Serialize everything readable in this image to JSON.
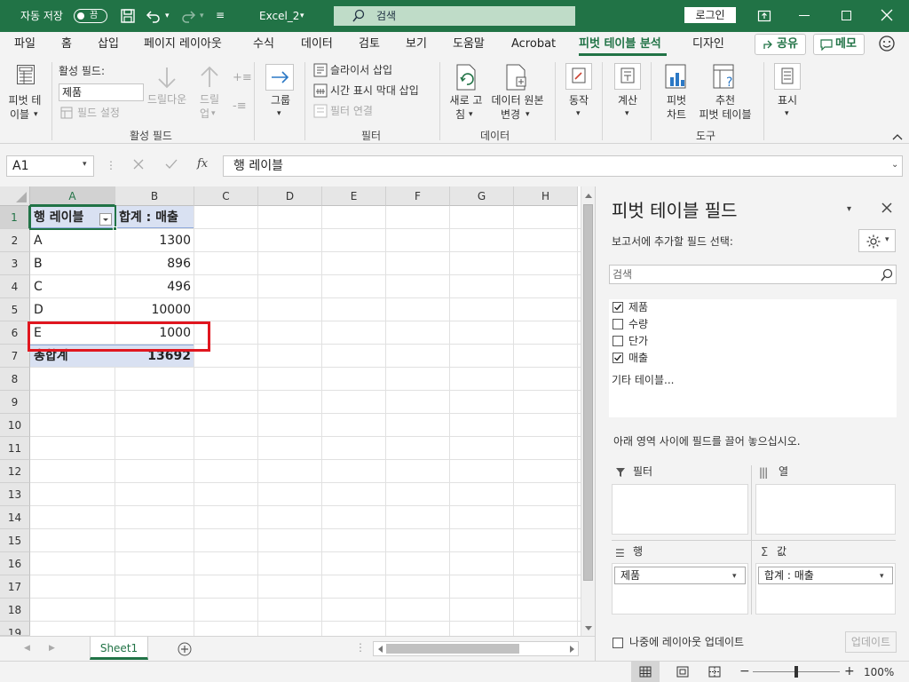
{
  "titlebar": {
    "autosave_label": "자동 저장",
    "autosave_state": "끔",
    "filename": "Excel_2",
    "search_placeholder": "검색",
    "login_label": "로그인"
  },
  "tabs": {
    "items": [
      "파일",
      "홈",
      "삽입",
      "페이지 레이아웃",
      "수식",
      "데이터",
      "검토",
      "보기",
      "도움말",
      "Acrobat",
      "피벗 테이블 분석",
      "디자인"
    ],
    "active": "피벗 테이블 분석",
    "share_label": "공유",
    "comment_label": "메모"
  },
  "ribbon": {
    "pivot_table": {
      "line1": "피벗 테",
      "line2": "이블"
    },
    "active_field": {
      "label": "활성 필드:",
      "value": "제품",
      "field_settings": "필드 설정",
      "drill_down": "드릴다운",
      "drill_up_1": "드릴",
      "drill_up_2": "업",
      "group_label": "활성 필드"
    },
    "group": {
      "label": "그룹"
    },
    "filter": {
      "slicer": "슬라이서 삽입",
      "timeline": "시간 표시 막대 삽입",
      "connections": "필터 연결",
      "group_label": "필터"
    },
    "data": {
      "refresh_1": "새로 고",
      "refresh_2": "침",
      "change_source_1": "데이터 원본",
      "change_source_2": "변경",
      "group_label": "데이터"
    },
    "actions": {
      "label": "동작"
    },
    "calculations": {
      "label": "계산"
    },
    "tools": {
      "pivot_chart_1": "피벗",
      "pivot_chart_2": "차트",
      "recommended_1": "추천",
      "recommended_2": "피벗 테이블",
      "group_label": "도구"
    },
    "show": {
      "label": "표시"
    }
  },
  "formula_bar": {
    "name_box": "A1",
    "formula": "행 레이블"
  },
  "grid": {
    "columns": [
      "A",
      "B",
      "C",
      "D",
      "E",
      "F",
      "G",
      "H"
    ],
    "rows": [
      "1",
      "2",
      "3",
      "4",
      "5",
      "6",
      "7",
      "8",
      "9",
      "10",
      "11",
      "12",
      "13",
      "14",
      "15",
      "16",
      "17",
      "18",
      "19"
    ],
    "header": {
      "row_label": "행 레이블",
      "sum_label": "합계 : 매출"
    },
    "data_rows": [
      {
        "label": "A",
        "value": "1300"
      },
      {
        "label": "B",
        "value": "896"
      },
      {
        "label": "C",
        "value": "496"
      },
      {
        "label": "D",
        "value": "10000"
      },
      {
        "label": "E",
        "value": "1000"
      }
    ],
    "total": {
      "label": "총합계",
      "value": "13692"
    },
    "highlight_color": "#e0161f",
    "pivot_header_fill": "#d9e1f2"
  },
  "sheets": {
    "tabs": [
      "Sheet1"
    ]
  },
  "pivot_pane": {
    "title": "피벗 테이블 필드",
    "subtitle": "보고서에 추가할 필드 선택:",
    "search_placeholder": "검색",
    "fields": [
      {
        "name": "제품",
        "checked": true
      },
      {
        "name": "수량",
        "checked": false
      },
      {
        "name": "단가",
        "checked": false
      },
      {
        "name": "매출",
        "checked": true
      }
    ],
    "more_tables": "기타 테이블...",
    "drag_hint": "아래 영역 사이에 필드를 끌어 놓으십시오.",
    "areas": {
      "filters": "필터",
      "columns": "열",
      "rows": "행",
      "values": "값",
      "rows_item": "제품",
      "values_item": "합계 : 매출"
    },
    "defer_update": "나중에 레이아웃 업데이트",
    "update_button": "업데이트"
  },
  "status": {
    "zoom": "100%"
  },
  "colors": {
    "accent": "#217346"
  }
}
